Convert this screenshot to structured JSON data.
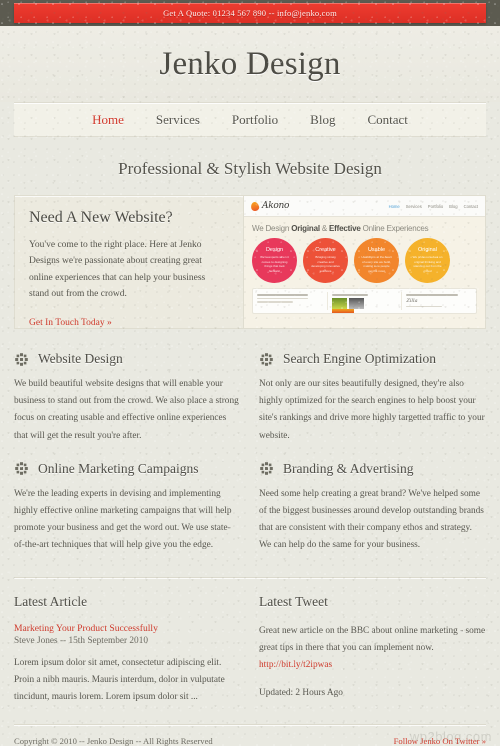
{
  "topbar": {
    "quote_text": "Get A Quote: 01234 567 890 -- info@jenko.com",
    "bar_color": "#e8342a"
  },
  "masthead": {
    "site_title": "Jenko Design"
  },
  "nav": {
    "items": [
      {
        "label": "Home",
        "active": true
      },
      {
        "label": "Services",
        "active": false
      },
      {
        "label": "Portfolio",
        "active": false
      },
      {
        "label": "Blog",
        "active": false
      },
      {
        "label": "Contact",
        "active": false
      }
    ]
  },
  "tagline": "Professional & Stylish Website Design",
  "hero": {
    "heading": "Need A New Website?",
    "body": "You've come to the right place. Here at Jenko Designs we're passionate about creating great online experiences that can help your business stand out from the crowd.",
    "cta": "Get In Touch Today »",
    "preview": {
      "brand": "Akono",
      "nav": [
        "Home",
        "Services",
        "Portfolio",
        "Blog",
        "Contact"
      ],
      "headline_pre": "We Design ",
      "headline_b1": "Original",
      "headline_mid": " & ",
      "headline_b2": "Effective",
      "headline_post": " Online Experiences",
      "circles": [
        {
          "title": "Design",
          "body": "We're experts when it comes to designing things that look fantastic",
          "color": "#e8385b"
        },
        {
          "title": "Creative",
          "body": "Bringing strong creative and developing innovative solutions",
          "color": "#ed5138"
        },
        {
          "title": "Usable",
          "body": "Usability is at the heart of every site we build, making sure people get the most",
          "color": "#f2862c"
        },
        {
          "title": "Original",
          "body": "We pride ourselves on original thinking and standing out from the crowd",
          "color": "#f5b22b"
        }
      ],
      "card_brand": "Zilla"
    }
  },
  "services": [
    {
      "icon": "floret-icon",
      "title": "Website Design",
      "body": "We build beautiful website designs that will enable your business to stand out from the crowd. We also place a strong focus on creating usable and effective online experiences that will get the result you're after."
    },
    {
      "icon": "floret-icon",
      "title": "Search Engine Optimization",
      "body": "Not only are our sites beautifully designed, they're also highly optimized for the search engines to help boost your site's rankings and drive more highly targetted traffic to your website."
    },
    {
      "icon": "floret-icon",
      "title": "Online Marketing Campaigns",
      "body": "We're the leading experts in devising and implementing highly effective online marketing campaigns that will help promote your business and get the word out. We use state-of-the-art techniques that will help give you the edge."
    },
    {
      "icon": "floret-icon",
      "title": "Branding & Advertising",
      "body": "Need some help creating a great brand? We've helped some of the biggest businesses around develop outstanding brands that are consistent with their company ethos and strategy. We can help do the same for your business."
    }
  ],
  "latest_article": {
    "heading": "Latest Article",
    "title": "Marketing Your Product Successfully",
    "meta": "Steve Jones -- 15th September 2010",
    "excerpt": "Lorem ipsum dolor sit amet, consectetur adipiscing elit. Proin a nibh mauris. Mauris interdum, dolor in vulputate tincidunt, mauris lorem. Lorem ipsum dolor sit ..."
  },
  "latest_tweet": {
    "heading": "Latest Tweet",
    "body": "Great new article on the BBC about online marketing - some great tips in there that you can implement now.",
    "link": "http://bit.ly/t2ipwas",
    "updated": "Updated: 2 Hours Ago"
  },
  "footer": {
    "copyright": "Copyright © 2010 -- Jenko Design -- All Rights Reserved",
    "twitter": "Follow Jenko On Twitter »"
  },
  "watermark": "wp2blog.com"
}
